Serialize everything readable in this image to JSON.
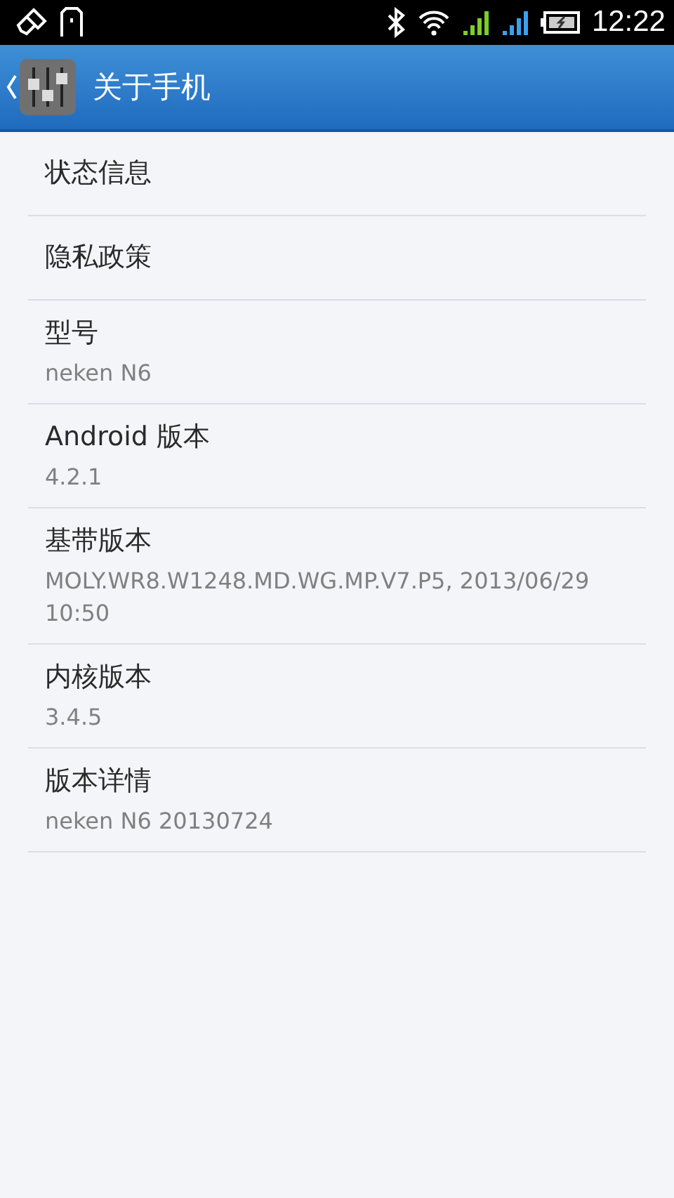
{
  "status_bar": {
    "time": "12:22"
  },
  "action_bar": {
    "title": "关于手机"
  },
  "items": [
    {
      "title": "状态信息"
    },
    {
      "title": "隐私政策"
    },
    {
      "title": "型号",
      "summary": "neken N6"
    },
    {
      "title": "Android 版本",
      "summary": "4.2.1"
    },
    {
      "title": "基带版本",
      "summary": "MOLY.WR8.W1248.MD.WG.MP.V7.P5, 2013/06/29 10:50"
    },
    {
      "title": "内核版本",
      "summary": "3.4.5"
    },
    {
      "title": "版本详情",
      "summary": "neken N6 20130724"
    }
  ]
}
